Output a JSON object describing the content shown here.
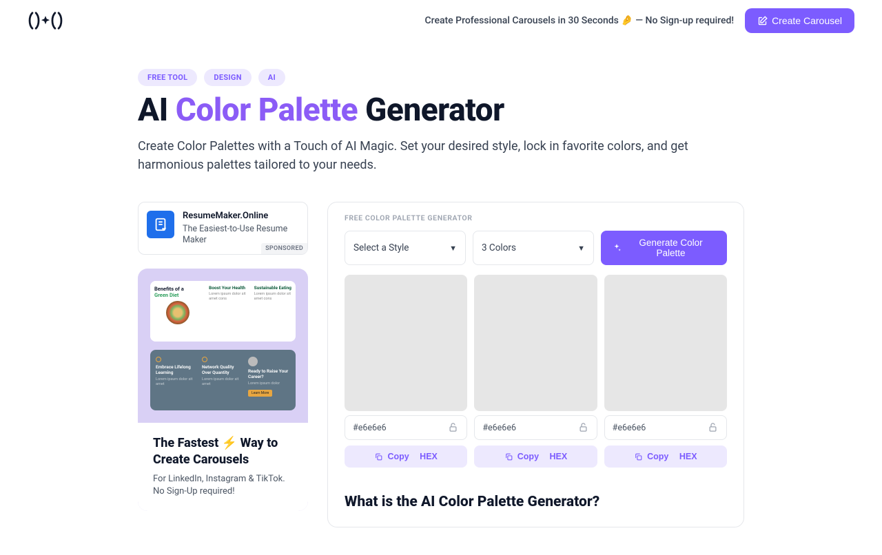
{
  "header": {
    "promo_text": "Create Professional Carousels in 30 Seconds 🤌 — No Sign-up required!",
    "cta_label": "Create Carousel"
  },
  "tags": [
    "FREE TOOL",
    "DESIGN",
    "AI"
  ],
  "title_prefix": "AI ",
  "title_accent": "Color Palette",
  "title_suffix": " Generator",
  "subtitle": "Create Color Palettes with a Touch of AI Magic. Set your desired style, lock in favorite colors, and get harmonious palettes tailored to your needs.",
  "ad": {
    "title": "ResumeMaker.Online",
    "desc": "The Easiest-to-Use Resume Maker",
    "badge": "SPONSORED"
  },
  "promo": {
    "title": "The Fastest ⚡ Way to Create Carousels",
    "desc": "For LinkedIn, Instagram & TikTok. No Sign-Up required!",
    "mock1_hdr_a": "Benefits of a",
    "mock1_hdr_b": "Green Diet",
    "mock1_t1": "Boost Your Health",
    "mock1_t2": "Sustainable Eating",
    "mock2_t1": "Embrace Lifelong Learning",
    "mock2_t2": "Network Quality Over Quantity",
    "mock2_t3": "Ready to Raise Your Career?"
  },
  "panel": {
    "label": "FREE COLOR PALETTE GENERATOR",
    "style_label": "Select a Style",
    "count_label": "3 Colors",
    "gen_label": "Generate Color Palette",
    "swatches": [
      {
        "hex": "#e6e6e6",
        "color": "#e6e6e6"
      },
      {
        "hex": "#e6e6e6",
        "color": "#e6e6e6"
      },
      {
        "hex": "#e6e6e6",
        "color": "#e6e6e6"
      }
    ],
    "copy_label_a": "Copy",
    "copy_label_b": "HEX"
  },
  "section_title": "What is the AI Color Palette Generator?"
}
